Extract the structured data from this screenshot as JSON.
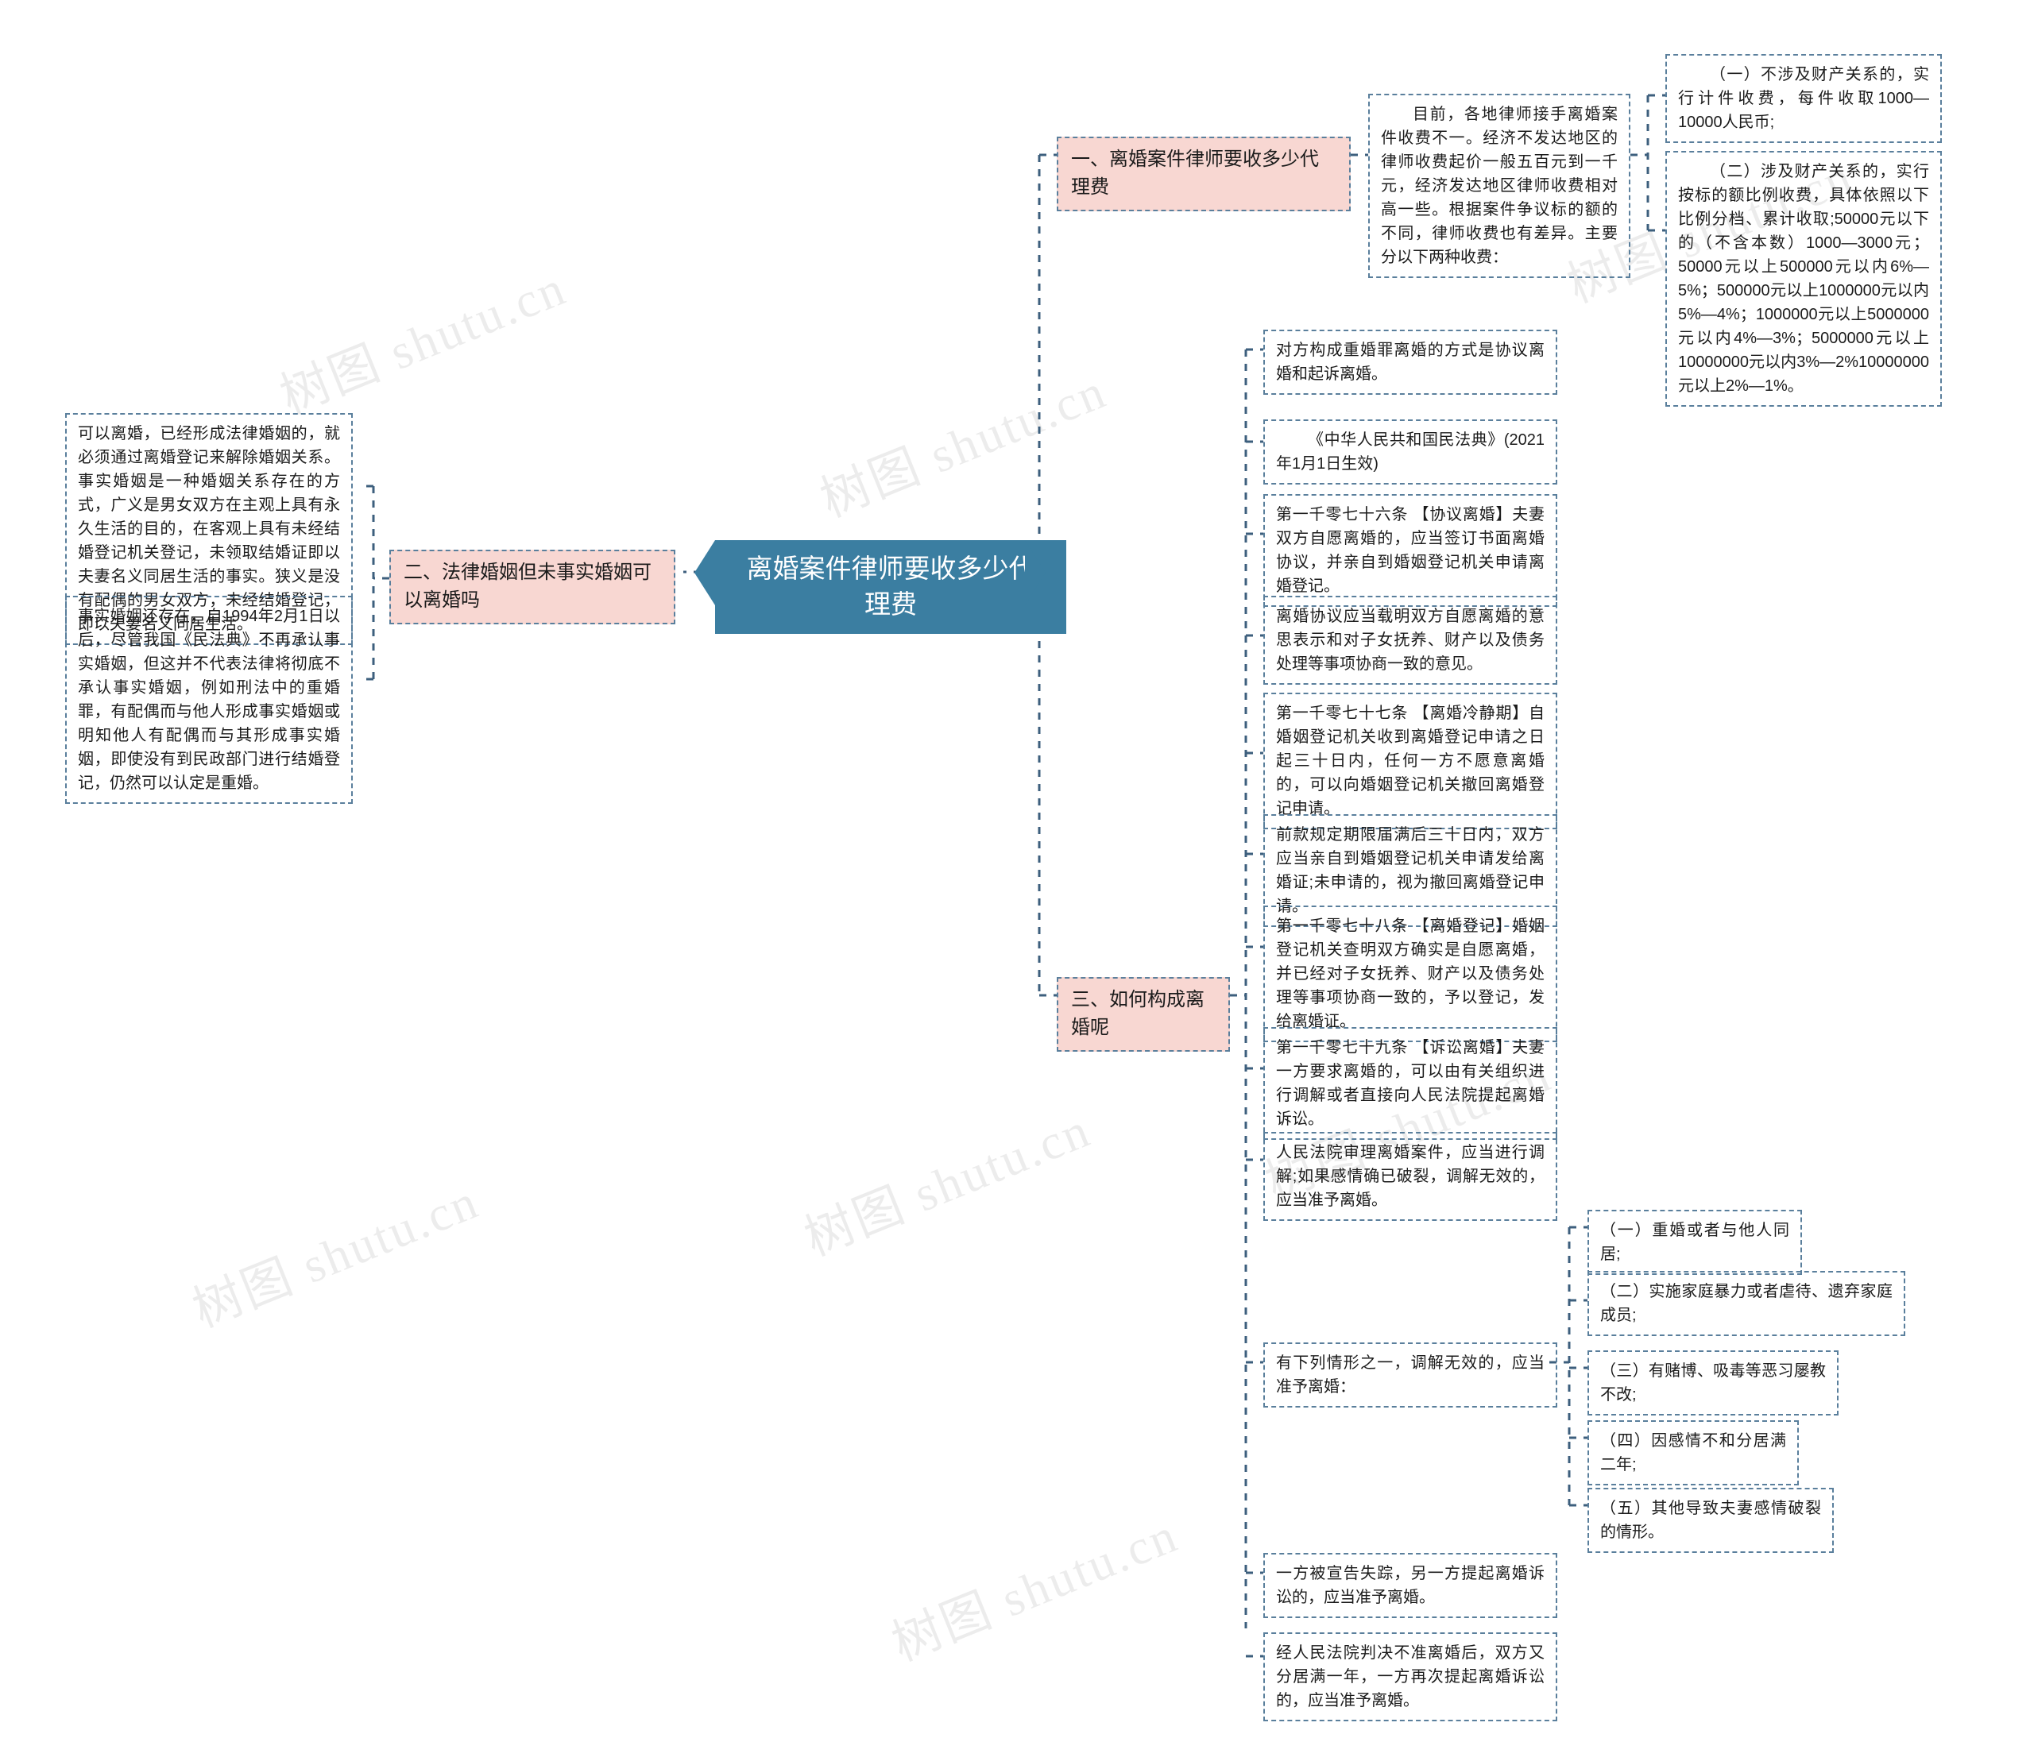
{
  "meta": {
    "watermark": "树图 shutu.cn"
  },
  "root": {
    "label": "离婚案件律师要收多少代理费"
  },
  "branches": [
    {
      "id": "branch-1",
      "label": "一、离婚案件律师要收多少代理费",
      "children": [
        {
          "id": "b1-intro",
          "text": "目前，各地律师接手离婚案件收费不一。经济不发达地区的律师收费起价一般五百元到一千元，经济发达地区律师收费相对高一些。根据案件争议标的额的不同，律师收费也有差异。主要分以下两种收费：",
          "children": [
            {
              "id": "b1-item-1",
              "text": "（一）不涉及财产关系的，实行计件收费，每件收取1000—10000人民币;"
            },
            {
              "id": "b1-item-2",
              "text": "（二）涉及财产关系的，实行按标的额比例收费，具体依照以下比例分档、累计收取;50000元以下的（不含本数）1000—3000元；50000元以上500000元以内6%—5%；500000元以上1000000元以内5%—4%；1000000元以上5000000元以内4%—3%；5000000元以上10000000元以内3%—2%10000000元以上2%—1%。"
            }
          ]
        }
      ]
    },
    {
      "id": "branch-2",
      "label": "二、法律婚姻但未事实婚姻可以离婚吗",
      "children": [
        {
          "id": "b2-item-1",
          "text": "可以离婚，已经形成法律婚姻的，就必须通过离婚登记来解除婚姻关系。事实婚姻是一种婚姻关系存在的方式，广义是男女双方在主观上具有永久生活的目的，在客观上具有未经结婚登记机关登记，未领取结婚证即以夫妻名义同居生活的事实。狭义是没有配偶的男女双方，未经结婚登记，即以夫妻名义同居生活。"
        },
        {
          "id": "b2-item-2",
          "text": "事实婚姻还存在，自1994年2月1日以后，尽管我国《民法典》不再承认事实婚姻，但这并不代表法律将彻底不承认事实婚姻，例如刑法中的重婚罪，有配偶而与他人形成事实婚姻或明知他人有配偶而与其形成事实婚姻，即使没有到民政部门进行结婚登记，仍然可以认定是重婚。"
        }
      ]
    },
    {
      "id": "branch-3",
      "label": "三、如何构成离婚呢",
      "children": [
        {
          "id": "b3-item-1",
          "text": "对方构成重婚罪离婚的方式是协议离婚和起诉离婚。"
        },
        {
          "id": "b3-item-2",
          "text": "《中华人民共和国民法典》(2021年1月1日生效)"
        },
        {
          "id": "b3-item-3",
          "text": "第一千零七十六条 【协议离婚】夫妻双方自愿离婚的，应当签订书面离婚协议，并亲自到婚姻登记机关申请离婚登记。"
        },
        {
          "id": "b3-item-4",
          "text": "离婚协议应当载明双方自愿离婚的意思表示和对子女抚养、财产以及债务处理等事项协商一致的意见。"
        },
        {
          "id": "b3-item-5",
          "text": "第一千零七十七条 【离婚冷静期】自婚姻登记机关收到离婚登记申请之日起三十日内，任何一方不愿意离婚的，可以向婚姻登记机关撤回离婚登记申请。"
        },
        {
          "id": "b3-item-6",
          "text": "前款规定期限届满后三十日内，双方应当亲自到婚姻登记机关申请发给离婚证;未申请的，视为撤回离婚登记申请。"
        },
        {
          "id": "b3-item-7",
          "text": "第一千零七十八条 【离婚登记】婚姻登记机关查明双方确实是自愿离婚，并已经对子女抚养、财产以及债务处理等事项协商一致的，予以登记，发给离婚证。"
        },
        {
          "id": "b3-item-8",
          "text": "第一千零七十九条 【诉讼离婚】夫妻一方要求离婚的，可以由有关组织进行调解或者直接向人民法院提起离婚诉讼。"
        },
        {
          "id": "b3-item-9",
          "text": "人民法院审理离婚案件，应当进行调解;如果感情确已破裂，调解无效的，应当准予离婚。"
        },
        {
          "id": "b3-item-10",
          "text": "有下列情形之一，调解无效的，应当准予离婚：",
          "children": [
            {
              "id": "b3-sub-1",
              "text": "（一）重婚或者与他人同居;"
            },
            {
              "id": "b3-sub-2",
              "text": "（二）实施家庭暴力或者虐待、遗弃家庭成员;"
            },
            {
              "id": "b3-sub-3",
              "text": "（三）有赌博、吸毒等恶习屡教不改;"
            },
            {
              "id": "b3-sub-4",
              "text": "（四）因感情不和分居满二年;"
            },
            {
              "id": "b3-sub-5",
              "text": "（五）其他导致夫妻感情破裂的情形。"
            }
          ]
        },
        {
          "id": "b3-item-11",
          "text": "一方被宣告失踪，另一方提起离婚诉讼的，应当准予离婚。"
        },
        {
          "id": "b3-item-12",
          "text": "经人民法院判决不准离婚后，双方又分居满一年，一方再次提起离婚诉讼的，应当准予离婚。"
        }
      ]
    }
  ],
  "colors": {
    "root_fill": "#3b7ea1",
    "root_text": "#ffffff",
    "topic_fill": "#f8d7d2",
    "border": "#5a7f9c",
    "text": "#1b1b1b"
  }
}
